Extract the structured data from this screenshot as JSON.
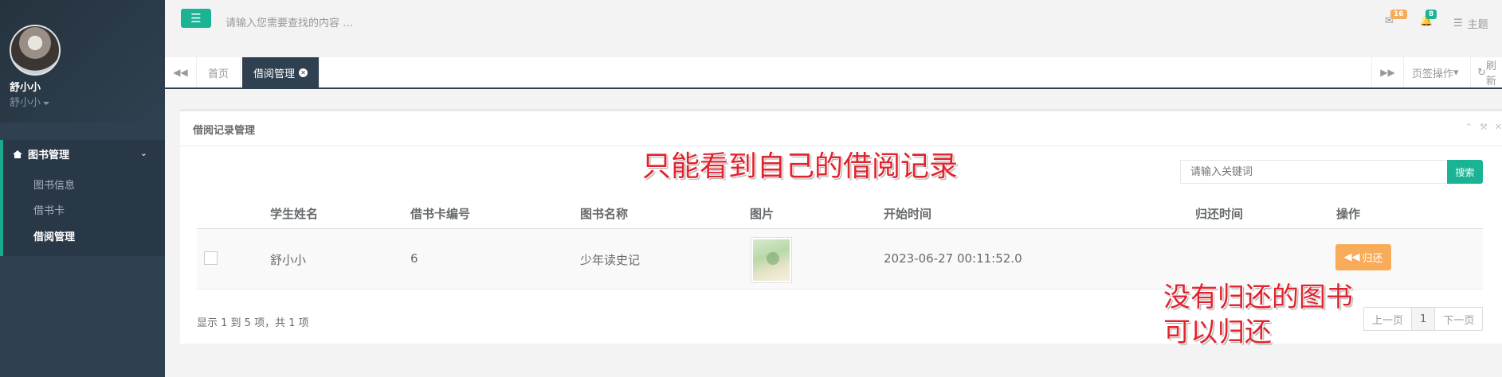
{
  "sidebar": {
    "user_name": "舒小小",
    "user_role": "舒小小",
    "group_label": "图书管理",
    "items": [
      {
        "label": "图书信息"
      },
      {
        "label": "借书卡"
      },
      {
        "label": "借阅管理"
      }
    ]
  },
  "topbar": {
    "search_placeholder": "请输入您需要查找的内容 …",
    "mail_count": "16",
    "bell_count": "8",
    "theme_label": "主题",
    "mail_badge_color": "#f8ac59",
    "bell_badge_color": "#1ab394"
  },
  "tabs": {
    "home": "首页",
    "active": "借阅管理",
    "page_ops": "页签操作",
    "refresh": "刷新"
  },
  "panel": {
    "title": "借阅记录管理",
    "keyword_placeholder": "请输入关键词",
    "search_button": "搜索",
    "columns": [
      "学生姓名",
      "借书卡编号",
      "图书名称",
      "图片",
      "开始时间",
      "归还时间",
      "操作"
    ],
    "rows": [
      {
        "student": "舒小小",
        "card_no": "6",
        "book": "少年读史记",
        "start": "2023-06-27 00:11:52.0",
        "return": "",
        "action": "归还"
      }
    ],
    "pager_info": "显示 1 到 5 项，共 1 项",
    "prev": "上一页",
    "page": "1",
    "next": "下一页"
  },
  "annotations": {
    "top": "只能看到自己的借阅记录",
    "bottom_line1": "没有归还的图书",
    "bottom_line2": "可以归还"
  }
}
